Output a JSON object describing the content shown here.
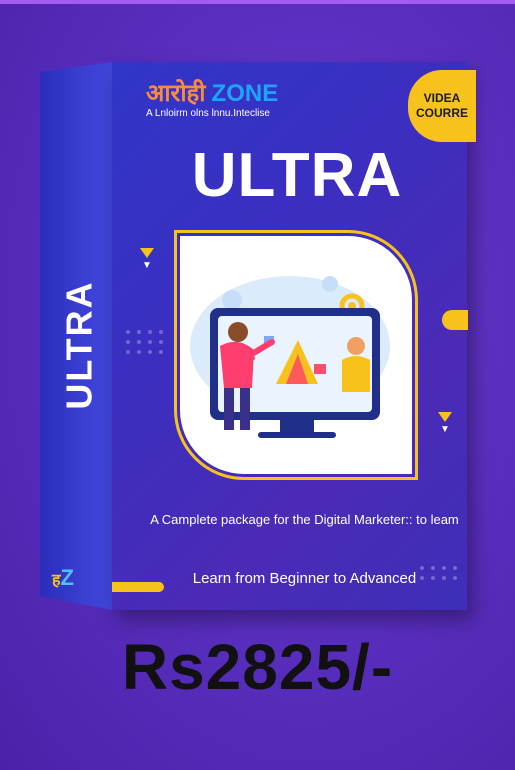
{
  "brand": {
    "name_hindi": "आरोही",
    "name_zone": "ZONE",
    "tagline": "A Lnloirm olns lnnu.Inteclise"
  },
  "badge": {
    "line1": "VIDEA",
    "line2": "COURRE"
  },
  "title": "ULTRA",
  "spine": {
    "title": "ULTRA",
    "logo_letters": "Z",
    "logo_glyph": "ह"
  },
  "description": "A Camplete package for the Digital Marketer:: to leam",
  "subtitle": "Learn from Beginner to Advanced",
  "price": "Rs2825/-",
  "colors": {
    "background": "#5a2fc0",
    "box_front": "#3a2fc0",
    "accent_yellow": "#f6c21b",
    "brand_orange": "#ff8a3d",
    "brand_blue": "#1ea4ff"
  },
  "icons": {
    "illustration": "person-presenting-at-monitor-illustration",
    "arrow": "chevron-down-icon"
  }
}
